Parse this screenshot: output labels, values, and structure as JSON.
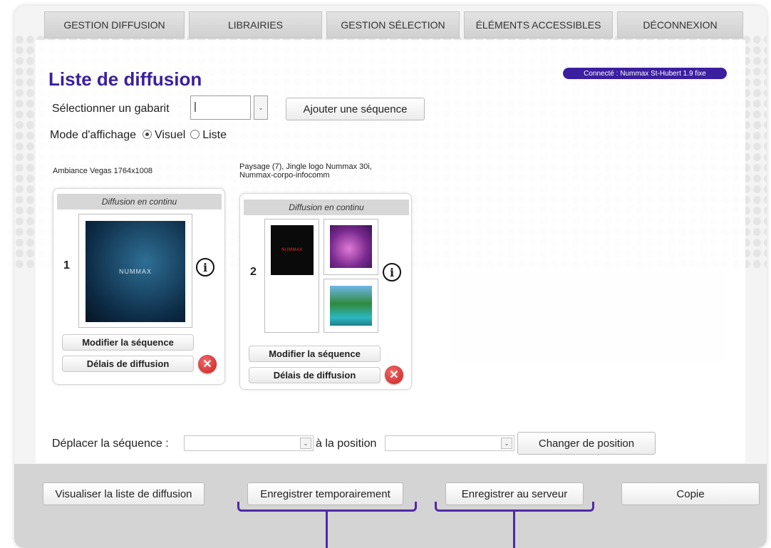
{
  "nav": {
    "tabs": [
      {
        "label": "GESTION DIFFUSION"
      },
      {
        "label": "LIBRAIRIES"
      },
      {
        "label": "GESTION SÉLECTION"
      },
      {
        "label": "ÉLÉMENTS ACCESSIBLES"
      },
      {
        "label": "DÉCONNEXION"
      }
    ]
  },
  "status": {
    "connected": "Connecté : Nummax St-Hubert 1.9 fixe",
    "accent": "#3b1f9e"
  },
  "page": {
    "title": "Liste de diffusion",
    "title_color": "#3b1f9e",
    "template_label": "Sélectionner un gabarit",
    "template_value": "|",
    "add_sequence": "Ajouter une séquence",
    "display_mode_label": "Mode d'affichage",
    "mode_visual": "Visuel",
    "mode_list": "Liste",
    "mode_selected": "Visuel"
  },
  "sequences": [
    {
      "caption": "Ambiance Vegas 1764x1008",
      "header": "Diffusion en continu",
      "number": "1",
      "thumb_text": "NUMMAX",
      "modify": "Modifier la séquence",
      "delays": "Délais de diffusion"
    },
    {
      "caption_line1": "Paysage (7), Jingle logo Nummax 30i,",
      "caption_line2": "Nummax-corpo-infocomm",
      "header": "Diffusion en continu",
      "number": "2",
      "thumb_text": "NUMMAX",
      "modify": "Modifier la séquence",
      "delays": "Délais de diffusion"
    }
  ],
  "move": {
    "label": "Déplacer la séquence :",
    "position_label": "à la position",
    "change_button": "Changer de position"
  },
  "footer": {
    "view_list": "Visualiser la liste de diffusion",
    "save_temp": "Enregistrer temporairement",
    "save_server": "Enregistrer au serveur",
    "copy": "Copie"
  }
}
